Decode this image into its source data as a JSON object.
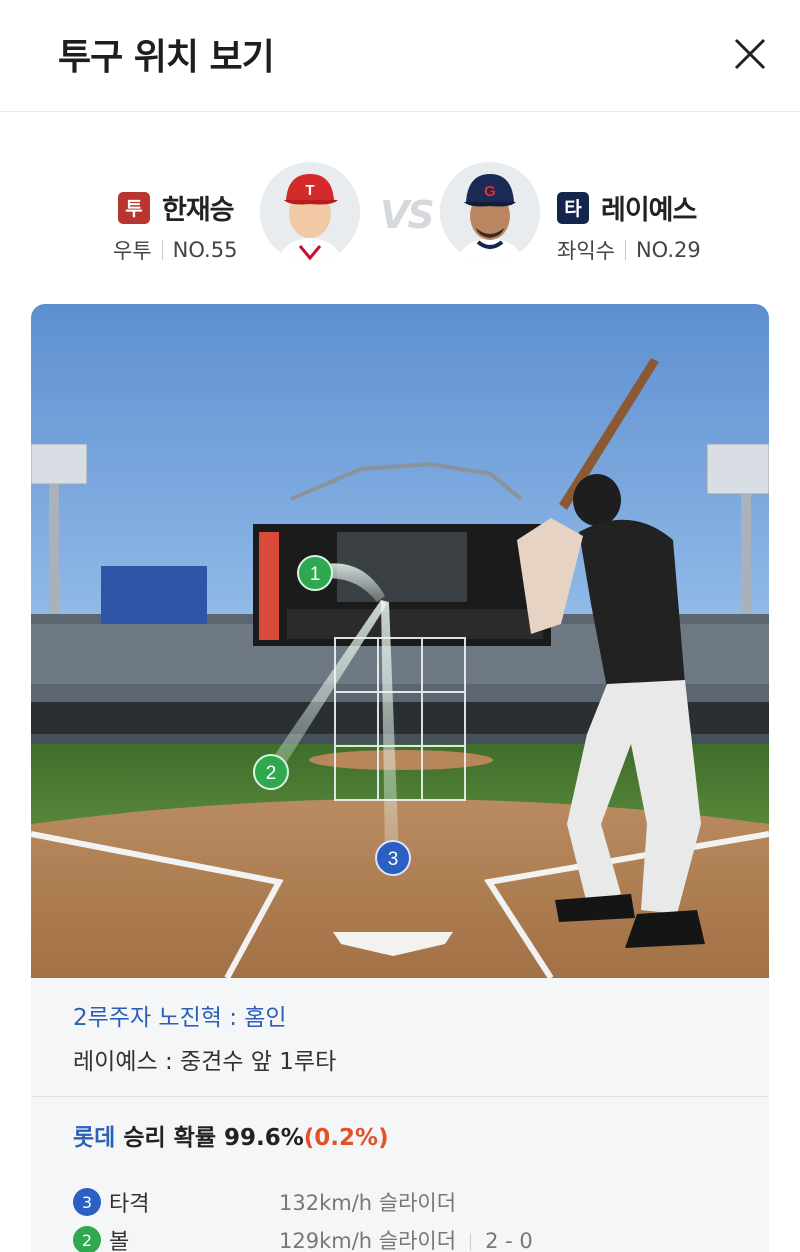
{
  "header": {
    "title": "투구 위치 보기"
  },
  "pitcher": {
    "role": "투",
    "name": "한재승",
    "hand": "우투",
    "number": "NO.55",
    "badge_color": "#b8362d"
  },
  "vs_label": "VS",
  "batter": {
    "role": "타",
    "name": "레이예스",
    "hand": "좌익수",
    "number": "NO.29",
    "badge_color": "#14254d"
  },
  "scene": {
    "pitch_markers": [
      {
        "label": "1",
        "type": "ball",
        "color": "#2fa84f"
      },
      {
        "label": "2",
        "type": "ball",
        "color": "#2fa84f"
      },
      {
        "label": "3",
        "type": "hit",
        "color": "#2b5fc2"
      }
    ]
  },
  "result": {
    "runner_text": "2루주자 노진혁 : 홈인",
    "batter_text": "레이예스 : 중견수 앞 1루타",
    "probability": {
      "team": "롯데",
      "label": " 승리 확률 ",
      "value": "99.6%",
      "change": "(0.2%)"
    },
    "pitches": [
      {
        "num": "3",
        "result": "타격",
        "speed": "132km/h",
        "pitch": "슬라이더",
        "count": "",
        "color": "#2b5fc2"
      },
      {
        "num": "2",
        "result": "볼",
        "speed": "129km/h",
        "pitch": "슬라이더",
        "count": "2 - 0",
        "color": "#2fa84f"
      }
    ]
  },
  "icons": {
    "close": "close-icon"
  }
}
